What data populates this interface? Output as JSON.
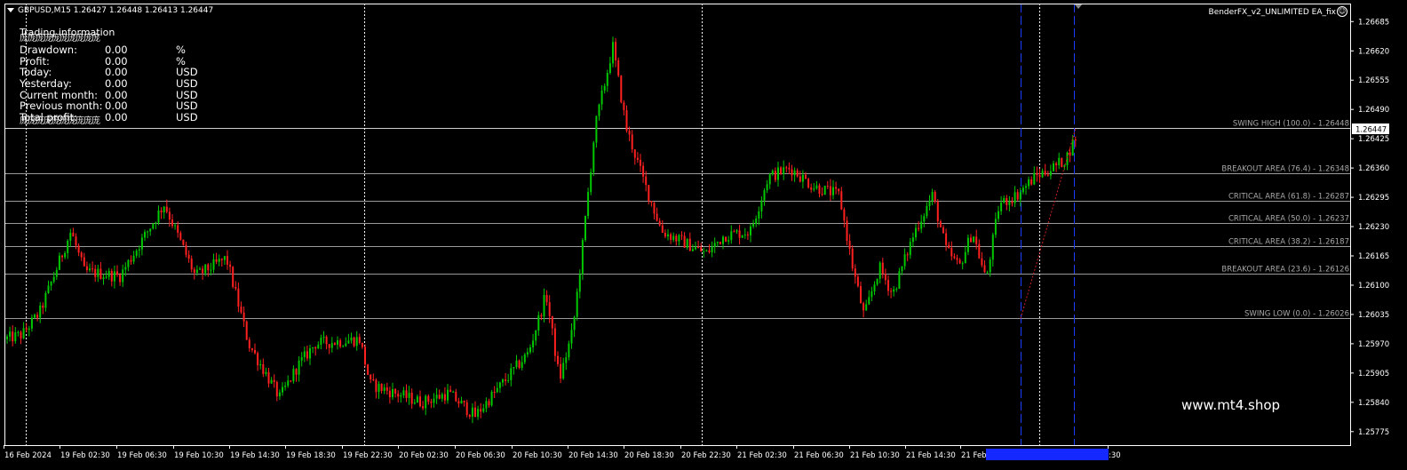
{
  "header": {
    "symbol_line": "GBPUSD,M15  1.26427 1.26448 1.26413 1.26447"
  },
  "ea_name": "BenderFX_v2_UNLIMITED EA_fix",
  "ea_icon": "smiley-icon",
  "panel": {
    "title": "Trading information",
    "filler": "庞庞庞庞庞庞庞庞庞庞",
    "rows": [
      {
        "label": "Drawdown:",
        "value": "0.00",
        "unit": "%"
      },
      {
        "label": "Profit:",
        "value": "0.00",
        "unit": "%"
      },
      {
        "label": "Today:",
        "value": "0.00",
        "unit": "USD"
      },
      {
        "label": "Yesterday:",
        "value": "0.00",
        "unit": "USD"
      },
      {
        "label": "Current month:",
        "value": "0.00",
        "unit": "USD"
      },
      {
        "label": "Previous month:",
        "value": "0.00",
        "unit": "USD"
      },
      {
        "label": "Total profit:",
        "value": "0.00",
        "unit": "USD"
      }
    ]
  },
  "watermark": "www.mt4.shop",
  "colors": {
    "bull": "#00c800",
    "bear": "#ff2020",
    "grid": "#ffffff",
    "fib": "#9a9a9a",
    "vline": "#1e3cff",
    "bg": "#000000"
  },
  "chart_data": {
    "type": "candlestick",
    "ylim": [
      1.25745,
      1.26725
    ],
    "y_ticks": [
      "1.26685",
      "1.26620",
      "1.26555",
      "1.26490",
      "1.26425",
      "1.26360",
      "1.26295",
      "1.26230",
      "1.26165",
      "1.26100",
      "1.26035",
      "1.25970",
      "1.25905",
      "1.25840",
      "1.25775"
    ],
    "current_price": "1.26447",
    "x_ticks": [
      "16 Feb 2024",
      "19 Feb 02:30",
      "19 Feb 06:30",
      "19 Feb 10:30",
      "19 Feb 14:30",
      "19 Feb 18:30",
      "19 Feb 22:30",
      "20 Feb 02:30",
      "20 Feb 06:30",
      "20 Feb 10:30",
      "20 Feb 14:30",
      "20 Feb 18:30",
      "20 Feb 22:30",
      "21 Feb 02:30",
      "21 Feb 06:30",
      "21 Feb 10:30",
      "21 Feb 14:30",
      "21 Feb",
      ":30"
    ],
    "fib_levels": [
      {
        "label": "SWING HIGH (100.0) - 1.26448",
        "price": 1.26448
      },
      {
        "label": "BREAKOUT AREA (76.4) -  1.26348",
        "price": 1.26348
      },
      {
        "label": "CRITICAL AREA (61.8) -  1.26287",
        "price": 1.26287
      },
      {
        "label": "CRITICAL AREA (50.0) -  1.26237",
        "price": 1.26237
      },
      {
        "label": "CRITICAL AREA (38.2) -  1.26187",
        "price": 1.26187
      },
      {
        "label": "BREAKOUT AREA (23.6) -  1.26126",
        "price": 1.26126
      },
      {
        "label": "SWING LOW (0.0) - 1.26026",
        "price": 1.26026
      }
    ],
    "path": [
      [
        0,
        1.2598
      ],
      [
        20,
        1.2599
      ],
      [
        40,
        1.2604
      ],
      [
        75,
        1.2622
      ],
      [
        90,
        1.2613
      ],
      [
        130,
        1.2612
      ],
      [
        180,
        1.2628
      ],
      [
        215,
        1.2612
      ],
      [
        250,
        1.2616
      ],
      [
        275,
        1.2597
      ],
      [
        310,
        1.2585
      ],
      [
        330,
        1.2592
      ],
      [
        350,
        1.2597
      ],
      [
        400,
        1.2598
      ],
      [
        412,
        1.2588
      ],
      [
        440,
        1.2586
      ],
      [
        470,
        1.2584
      ],
      [
        500,
        1.2586
      ],
      [
        530,
        1.2581
      ],
      [
        560,
        1.2588
      ],
      [
        590,
        1.2595
      ],
      [
        610,
        1.2608
      ],
      [
        625,
        1.2589
      ],
      [
        640,
        1.26
      ],
      [
        650,
        1.2617
      ],
      [
        665,
        1.2645
      ],
      [
        685,
        1.2663
      ],
      [
        700,
        1.2645
      ],
      [
        720,
        1.2633
      ],
      [
        740,
        1.2622
      ],
      [
        760,
        1.262
      ],
      [
        790,
        1.2617
      ],
      [
        810,
        1.2621
      ],
      [
        840,
        1.2622
      ],
      [
        860,
        1.2634
      ],
      [
        885,
        1.2636
      ],
      [
        910,
        1.2632
      ],
      [
        940,
        1.263
      ],
      [
        955,
        1.2614
      ],
      [
        968,
        1.2603
      ],
      [
        985,
        1.2614
      ],
      [
        1000,
        1.2608
      ],
      [
        1025,
        1.2622
      ],
      [
        1045,
        1.263
      ],
      [
        1060,
        1.2618
      ],
      [
        1075,
        1.2614
      ],
      [
        1090,
        1.2622
      ],
      [
        1105,
        1.2611
      ],
      [
        1120,
        1.2628
      ],
      [
        1140,
        1.263
      ],
      [
        1160,
        1.2634
      ],
      [
        1180,
        1.2636
      ],
      [
        1195,
        1.2638
      ],
      [
        1210,
        1.26447
      ]
    ]
  }
}
